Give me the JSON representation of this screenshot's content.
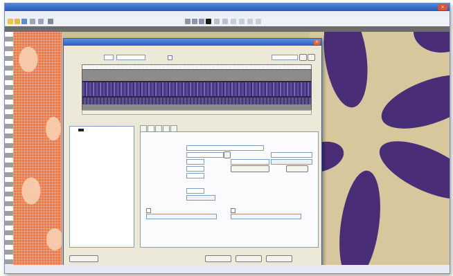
{
  "window": {
    "title": "",
    "close_glyph": "×"
  },
  "menu": {
    "items": [
      "",
      "",
      "",
      "",
      ""
    ]
  },
  "dialog": {
    "title": "",
    "close_glyph": "×",
    "tabs": [
      "",
      "",
      "",
      "",
      ""
    ],
    "fields": {
      "cord_name": "",
      "cord_type": "",
      "count_unit": "",
      "extra_size": "",
      "extension_size": "",
      "twist_rate": ""
    },
    "buttons": {
      "default_values": "",
      "ok": "",
      "cancel": "",
      "apply": "",
      "details": ""
    },
    "tree_item": ""
  },
  "colors": {
    "accent": "#2a5fc2",
    "fabric_purple": "#4a2d77",
    "fabric_beige": "#d7c79c",
    "pattern_orange": "#ee7a49"
  },
  "icons": [
    "zoom-in-icon",
    "zoom-out-icon",
    "close-icon"
  ]
}
